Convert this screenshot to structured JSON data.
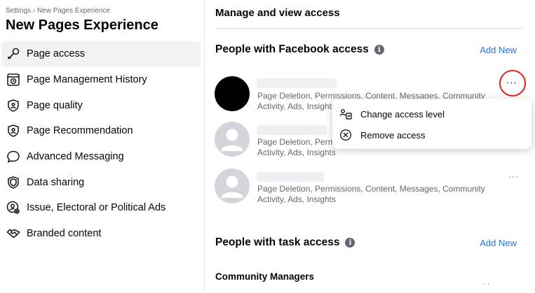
{
  "sidebar": {
    "breadcrumb": "Settings › New Pages Experience",
    "title": "New Pages Experience",
    "items": [
      {
        "label": "Page access",
        "icon": "key-icon",
        "active": true
      },
      {
        "label": "Page Management History",
        "icon": "history-icon",
        "active": false
      },
      {
        "label": "Page quality",
        "icon": "shield-quality-icon",
        "active": false
      },
      {
        "label": "Page Recommendation",
        "icon": "shield-recommend-icon",
        "active": false
      },
      {
        "label": "Advanced Messaging",
        "icon": "chat-bubble-icon",
        "active": false
      },
      {
        "label": "Data sharing",
        "icon": "shield-data-icon",
        "active": false
      },
      {
        "label": "Issue, Electoral or Political Ads",
        "icon": "person-gear-icon",
        "active": false
      },
      {
        "label": "Branded content",
        "icon": "handshake-icon",
        "active": false
      }
    ]
  },
  "main": {
    "heading": "Manage and view access",
    "facebook_access": {
      "title": "People with Facebook access",
      "add_new": "Add New",
      "people": [
        {
          "permissions": "Page Deletion, Permissions, Content, Messages, Community Activity, Ads, Insights",
          "avatar": "black"
        },
        {
          "permissions": "Page Deletion, Permissions, Content, Messages, Community Activity, Ads, Insights",
          "avatar": "gray"
        },
        {
          "permissions": "Page Deletion, Permissions, Content, Messages, Community Activity, Ads, Insights",
          "avatar": "gray"
        }
      ],
      "more_label": "···"
    },
    "menu": {
      "items": [
        {
          "label": "Change access level",
          "icon": "change-access-icon"
        },
        {
          "label": "Remove access",
          "icon": "remove-circle-icon"
        }
      ]
    },
    "task_access": {
      "title": "People with task access",
      "add_new": "Add New",
      "subheading": "Community Managers"
    }
  },
  "colors": {
    "accent": "#1877f2",
    "highlight": "#e02020",
    "muted": "#65676b"
  }
}
